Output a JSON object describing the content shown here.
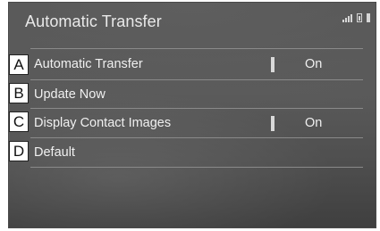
{
  "screen": {
    "title": "Automatic Transfer"
  },
  "status_icons": [
    "signal-icon",
    "battery-icon",
    "phone-icon"
  ],
  "rows": [
    {
      "callout": "A",
      "label": "Automatic Transfer",
      "value": "On",
      "toggle": true
    },
    {
      "callout": "B",
      "label": "Update Now"
    },
    {
      "callout": "C",
      "label": "Display Contact Images",
      "value": "On",
      "toggle": true
    },
    {
      "callout": "D",
      "label": "Default"
    }
  ]
}
